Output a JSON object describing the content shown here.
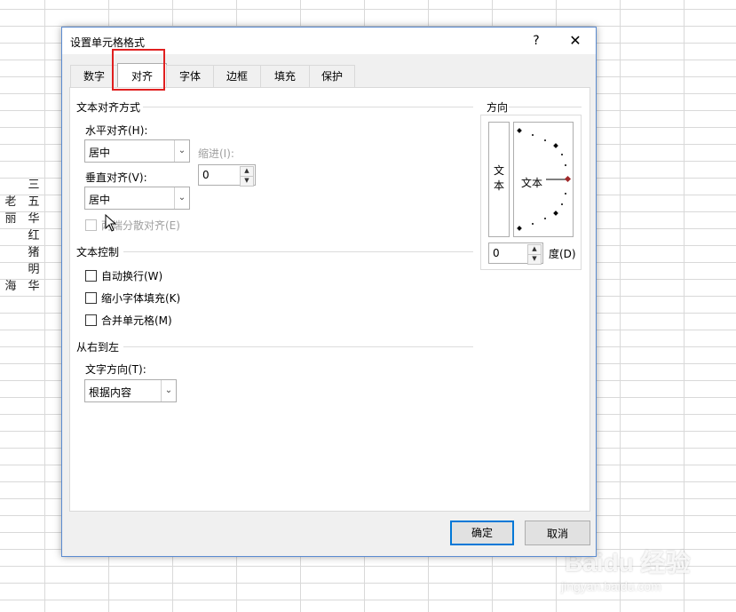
{
  "sheet": {
    "col_a": [
      "老",
      "丽",
      "",
      "",
      "",
      "海"
    ],
    "col_b": [
      "三",
      "五",
      "华",
      "红",
      "猪",
      "明",
      "华"
    ],
    "watermark": "Baidu 经验",
    "watermark_sub": "jingyan.baidu.com"
  },
  "dialog": {
    "title": "设置单元格格式",
    "help_label": "?",
    "close_label": "✕",
    "tabs": [
      "数字",
      "对齐",
      "字体",
      "边框",
      "填充",
      "保护"
    ],
    "active_tab": "对齐",
    "text_alignment": {
      "group_label": "文本对齐方式",
      "horizontal_label": "水平对齐(H):",
      "horizontal_value": "居中",
      "indent_label": "缩进(I):",
      "indent_value": "0",
      "vertical_label": "垂直对齐(V):",
      "vertical_value": "居中",
      "distributed_label": "两端分散对齐(E)"
    },
    "text_control": {
      "group_label": "文本控制",
      "wrap_label": "自动换行(W)",
      "shrink_label": "缩小字体填充(K)",
      "merge_label": "合并单元格(M)"
    },
    "rtl": {
      "group_label": "从右到左",
      "direction_label": "文字方向(T):",
      "direction_value": "根据内容"
    },
    "orientation": {
      "group_label": "方向",
      "vertical_text": "文本",
      "dial_text": "文本",
      "degree_value": "0",
      "degree_label": "度(D)"
    },
    "ok_label": "确定",
    "cancel_label": "取消"
  },
  "colors": {
    "highlight": "#e02020",
    "dial_marker": "#a0282a",
    "default_button_border": "#0078d7"
  }
}
